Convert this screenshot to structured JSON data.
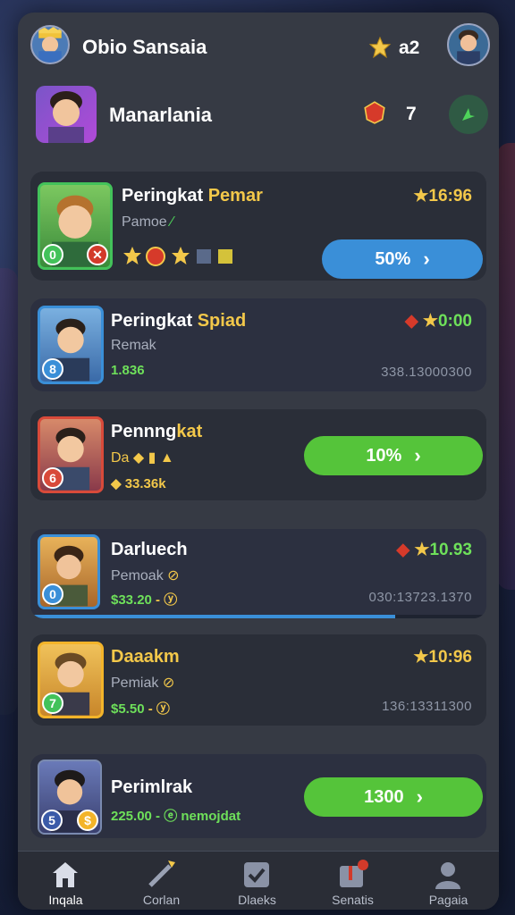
{
  "header": {
    "user_name": "Obio Sansaia",
    "user_score": "a2",
    "second_name": "Manarlania",
    "second_score": "7"
  },
  "cards": [
    {
      "title_a": "Peringkat ",
      "title_b": "Pemar",
      "subtitle": "Pamoe",
      "rank_badge": "0",
      "button_label": "50%",
      "score": "16:96",
      "colors": {
        "title_b": "#f3c84a",
        "button": "#3a8fd8"
      }
    },
    {
      "title_a": "Peringkat ",
      "title_b": "Spiad",
      "subtitle": "Remak",
      "rank_badge": "8",
      "meta": "1.836",
      "score": "0:00",
      "code": "338.13000300",
      "colors": {
        "title_b": "#f3c84a",
        "meta": "#6ee05a",
        "score": "#6ee05a"
      }
    },
    {
      "title_a": "Pennng",
      "title_b": "kat",
      "subtitle": "Da",
      "rank_badge": "6",
      "meta": "33.36k",
      "button_label": "10%",
      "colors": {
        "title_b": "#f3c84a",
        "meta": "#f3c84a",
        "button": "#55c43a"
      }
    },
    {
      "title_a": "Darluech",
      "subtitle": "Pemoak",
      "rank_badge": "0",
      "meta": "$33.20",
      "score": "10.93",
      "code": "030:13723.1370",
      "progress": 0.8,
      "colors": {
        "meta": "#6ee05a",
        "score": "#6ee05a"
      }
    },
    {
      "title_a": "Daaakm",
      "subtitle": "Pemiak",
      "rank_badge": "7",
      "meta": "$5.50",
      "score": "10:96",
      "code": "136:13311300",
      "colors": {
        "title_a": "#f3c84a",
        "meta": "#6ee05a",
        "score": "#f3c84a"
      }
    },
    {
      "title_a": "Perimlrak",
      "rank_badge": "5",
      "meta": "225.00",
      "meta_extra": "nemojdat",
      "button_label": "1300",
      "colors": {
        "meta": "#6ee05a",
        "button": "#55c43a"
      }
    }
  ],
  "tabs": [
    {
      "label": "Inqala",
      "icon": "home-icon"
    },
    {
      "label": "Corlan",
      "icon": "sword-icon"
    },
    {
      "label": "Dlaeks",
      "icon": "checkbox-icon"
    },
    {
      "label": "Senatis",
      "icon": "book-icon"
    },
    {
      "label": "Pagaia",
      "icon": "profile-icon"
    }
  ],
  "colors": {
    "panel": "#363a44",
    "card": "#2a2e38",
    "blue_button": "#3a8fd8",
    "green_button": "#55c43a",
    "gold": "#f3c84a",
    "green_text": "#6ee05a"
  }
}
